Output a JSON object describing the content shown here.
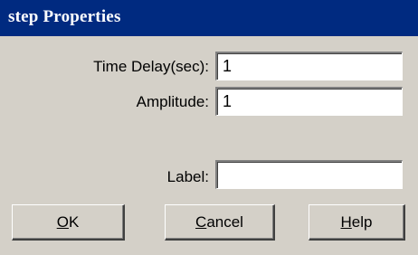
{
  "window": {
    "title": "step Properties"
  },
  "fields": {
    "time_delay": {
      "label": "Time Delay(sec):",
      "value": "1"
    },
    "amplitude": {
      "label": "Amplitude:",
      "value": "1"
    },
    "label": {
      "label": "Label:",
      "value": ""
    }
  },
  "buttons": {
    "ok": {
      "mnemonic": "O",
      "rest": "K"
    },
    "cancel": {
      "mnemonic": "C",
      "rest": "ancel"
    },
    "help": {
      "mnemonic": "H",
      "rest": "elp"
    }
  },
  "colors": {
    "titlebar": "#002a80",
    "dialog_face": "#d4d0c8"
  }
}
